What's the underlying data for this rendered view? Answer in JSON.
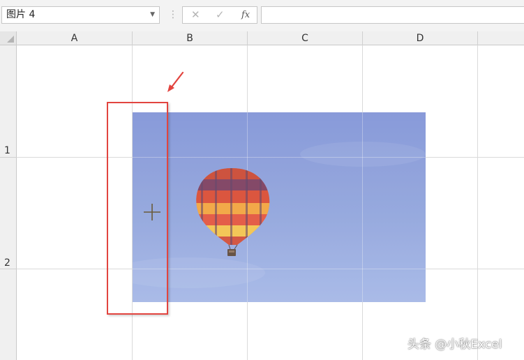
{
  "formula_bar": {
    "name_box": "图片 4",
    "cancel_icon": "✕",
    "enter_icon": "✓",
    "fx_label": "fx",
    "formula_value": ""
  },
  "columns": [
    "A",
    "B",
    "C",
    "D"
  ],
  "rows": [
    "1",
    "2"
  ],
  "picture": {
    "name": "hot-air-balloon-image"
  },
  "watermark": "头条 @小秋Excel",
  "colors": {
    "highlight": "#e2443f",
    "sky": "#8fa3dc"
  }
}
